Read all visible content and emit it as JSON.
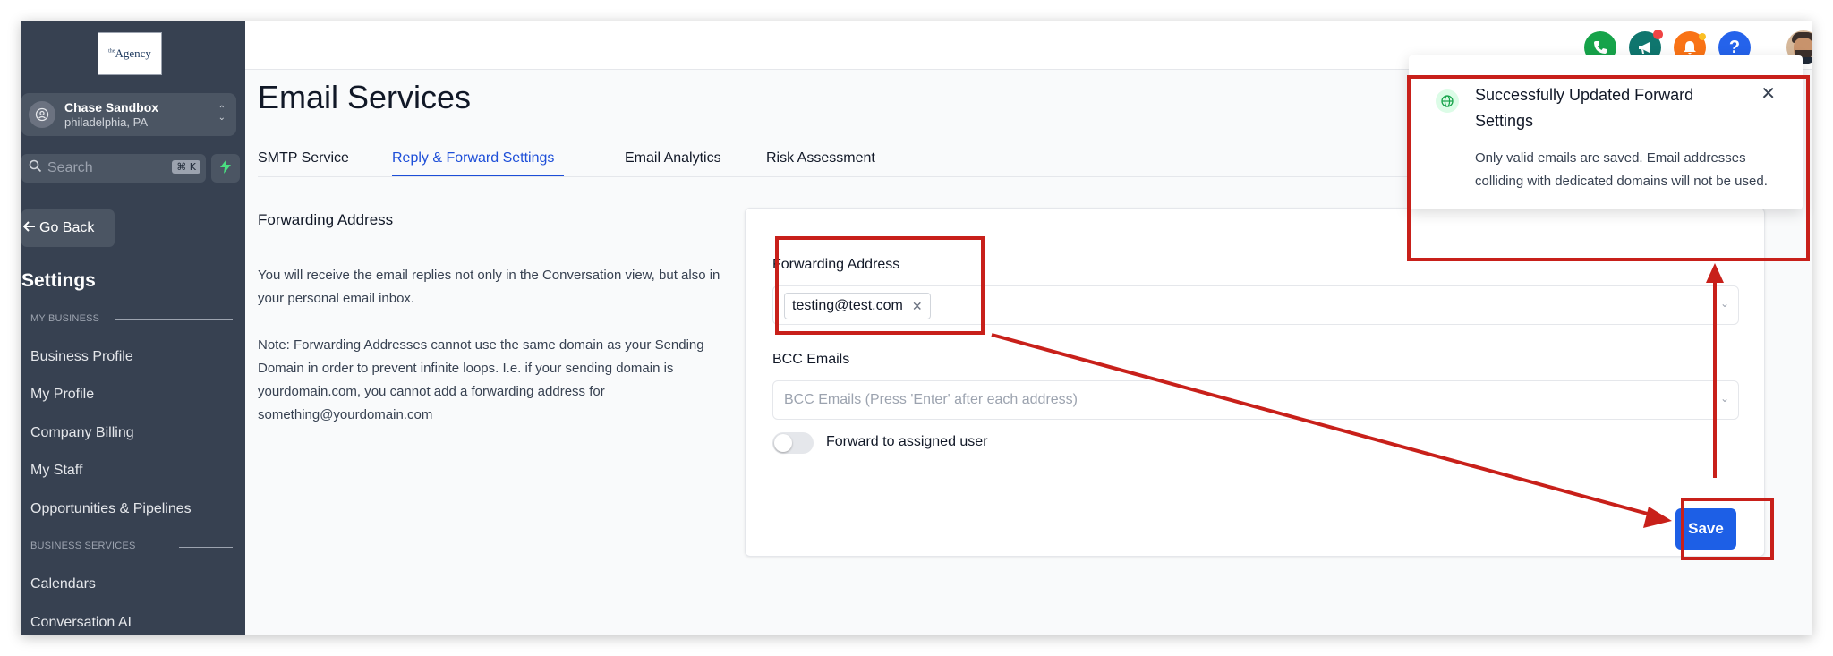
{
  "sidebar": {
    "logo_text": "Agency",
    "logo_prefix": "the",
    "account": {
      "name": "Chase Sandbox",
      "location": "philadelphia, PA"
    },
    "search": {
      "placeholder": "Search",
      "shortcut": "⌘ K"
    },
    "go_back": "Go Back",
    "settings_title": "Settings",
    "sections": [
      {
        "label": "MY BUSINESS",
        "items": [
          "Business Profile",
          "My Profile",
          "Company Billing",
          "My Staff",
          "Opportunities & Pipelines"
        ]
      },
      {
        "label": "BUSINESS SERVICES",
        "items": [
          "Calendars",
          "Conversation AI"
        ]
      }
    ]
  },
  "header": {
    "icons": [
      {
        "name": "phone-icon",
        "color": "#16a34a",
        "glyph": "✆"
      },
      {
        "name": "megaphone-icon",
        "color": "#0f766e",
        "glyph": "📢"
      },
      {
        "name": "bell-icon",
        "color": "#f97316",
        "glyph": "🔔"
      },
      {
        "name": "help-icon",
        "color": "#2563eb",
        "glyph": "?"
      }
    ]
  },
  "page": {
    "title": "Email Services",
    "tabs": [
      "SMTP Service",
      "Reply & Forward Settings",
      "Email Analytics",
      "Risk Assessment"
    ],
    "active_tab": "Reply & Forward Settings"
  },
  "description": {
    "title": "Forwarding Address",
    "paragraph1": "You will receive the email replies not only in the Conversation view, but also in your personal email inbox.",
    "paragraph2": "Note: Forwarding Addresses cannot use the same domain as your Sending Domain in order to prevent infinite loops. I.e. if your sending domain is yourdomain.com, you cannot add a forwarding address for something@yourdomain.com"
  },
  "form": {
    "forwarding_label": "Forwarding Address",
    "forwarding_value": "testing@test.com",
    "bcc_label": "BCC Emails",
    "bcc_placeholder": "BCC Emails (Press 'Enter' after each address)",
    "toggle_label": "Forward to assigned user",
    "toggle_on": false,
    "save_label": "Save"
  },
  "toast": {
    "title": "Successfully Updated Forward Settings",
    "message": "Only valid emails are saved. Email addresses colliding with dedicated domains will not be used."
  },
  "colors": {
    "sidebar_bg": "#374151",
    "accent": "#1d4ed8",
    "save_button": "#1d5fe6",
    "annotation_red": "#c8201a"
  }
}
